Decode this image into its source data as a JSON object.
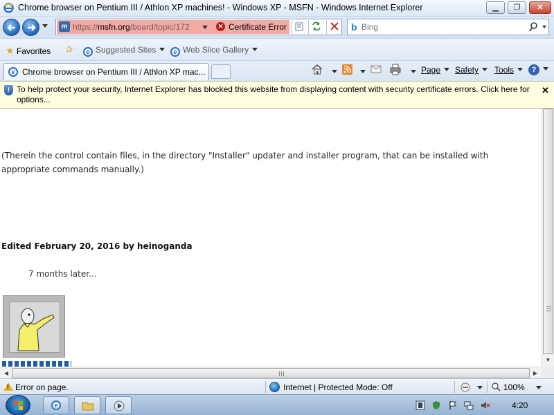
{
  "window": {
    "title": "Chrome browser on Pentium III / Athlon XP machines! - Windows XP - MSFN - Windows Internet Explorer",
    "min_glyph": "▁",
    "max_glyph": "❐",
    "close_glyph": "✕"
  },
  "address": {
    "scheme": "https://",
    "host": "msfn.org",
    "path": "/board/topic/172",
    "cert_error_label": "Certificate Error",
    "cert_error_glyph": "✕",
    "site_glyph": "m"
  },
  "search": {
    "placeholder": "Bing",
    "logo_glyph": "b",
    "go_glyph": "⌕"
  },
  "favorites_bar": {
    "favorites_label": "Favorites",
    "items": [
      {
        "label": "Suggested Sites"
      },
      {
        "label": "Web Slice Gallery"
      }
    ]
  },
  "tabs": [
    {
      "title": "Chrome browser on Pentium III / Athlon XP mac..."
    }
  ],
  "command_bar": {
    "page_label": "Page",
    "safety_label": "Safety",
    "tools_label": "Tools",
    "help_glyph": "?"
  },
  "infobar": {
    "text": "To help protect your security, Internet Explorer has blocked this website from displaying content with security certificate errors. Click here for options...",
    "close_glyph": "✕",
    "shield_glyph": "!"
  },
  "content": {
    "paragraph": "(Therein the control contain files, in the directory \"Installer\" updater and installer program, that can be installed with appropriate commands manually.)",
    "edited_line": "Edited February 20, 2016 by heinoganda",
    "later_text": "7 months later..."
  },
  "scrollbars": {
    "vertical_position_fraction": 0.0,
    "horizontal_position_fraction": 0.0,
    "arrow_down": "▼",
    "arrow_left": "◀",
    "arrow_right": "▶"
  },
  "status_bar": {
    "status_text": "Error on page.",
    "zone_text": "Internet | Protected Mode: Off",
    "zoom_text": "100%"
  },
  "taskbar": {
    "clock": "4:20"
  },
  "colors": {
    "address_error_bg": "#f2aaa5",
    "infobar_bg": "#fffee1",
    "link_blue": "#1f5fa8"
  }
}
